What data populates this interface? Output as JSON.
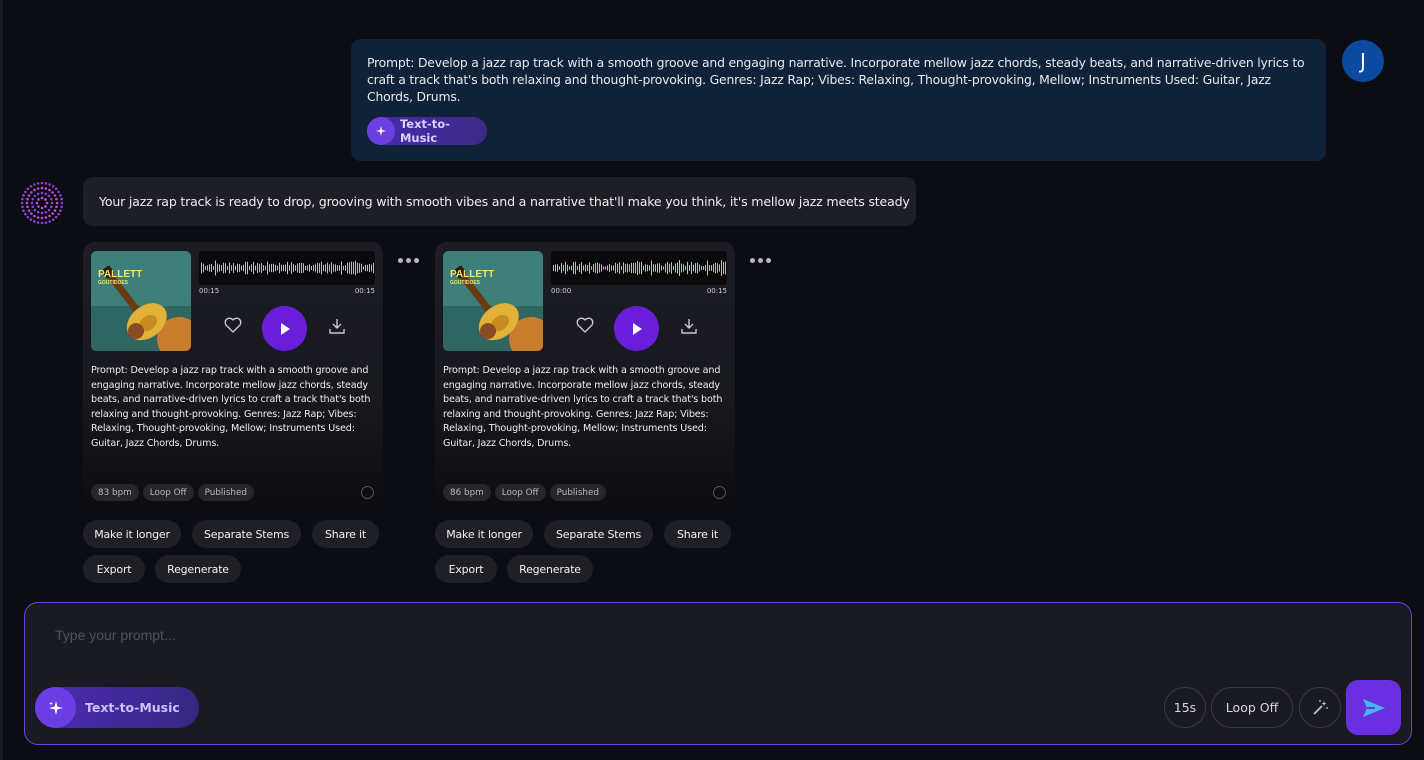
{
  "user": {
    "avatar_letter": "J",
    "prompt": "Prompt: Develop a jazz rap track with a smooth groove and engaging narrative. Incorporate mellow jazz chords, steady beats, and narrative-driven lyrics to craft a track that's both relaxing and thought-provoking. Genres: Jazz Rap; Vibes: Relaxing, Thought-provoking, Mellow; Instruments Used: Guitar, Jazz Chords, Drums.",
    "mode_label": "Text-to-Music"
  },
  "assistant": {
    "message": "Your jazz rap track is ready to drop, grooving with smooth vibes and a narrative that'll make you think, it's mellow jazz meets steady"
  },
  "tracks": [
    {
      "cover_title": "PALLETT",
      "cover_subtitle": "GOUTIDOES",
      "time_left": "00:15",
      "time_right": "00:15",
      "description": "Prompt: Develop a jazz rap track with a smooth groove and engaging narrative. Incorporate mellow jazz chords, steady beats, and narrative-driven lyrics to craft a track that's both relaxing and thought-provoking. Genres: Jazz Rap; Vibes: Relaxing, Thought-provoking, Mellow; Instruments Used: Guitar, Jazz Chords, Drums.",
      "bpm": "83 bpm",
      "loop": "Loop Off",
      "status": "Published",
      "actions": [
        "Make it longer",
        "Separate Stems",
        "Share it",
        "Export",
        "Regenerate"
      ]
    },
    {
      "cover_title": "PALLETT",
      "cover_subtitle": "GOUTIDOES",
      "time_left": "00:00",
      "time_right": "00:15",
      "description": "Prompt: Develop a jazz rap track with a smooth groove and engaging narrative. Incorporate mellow jazz chords, steady beats, and narrative-driven lyrics to craft a track that's both relaxing and thought-provoking. Genres: Jazz Rap; Vibes: Relaxing, Thought-provoking, Mellow; Instruments Used: Guitar, Jazz Chords, Drums.",
      "bpm": "86 bpm",
      "loop": "Loop Off",
      "status": "Published",
      "actions": [
        "Make it longer",
        "Separate Stems",
        "Share it",
        "Export",
        "Regenerate"
      ]
    }
  ],
  "composer": {
    "placeholder": "Type your prompt...",
    "mode_label": "Text-to-Music",
    "duration": "15s",
    "loop": "Loop Off"
  },
  "colors": {
    "accent": "#6a1ed9",
    "user_bubble": "#0f2237",
    "avatar": "#0c4aa0"
  }
}
